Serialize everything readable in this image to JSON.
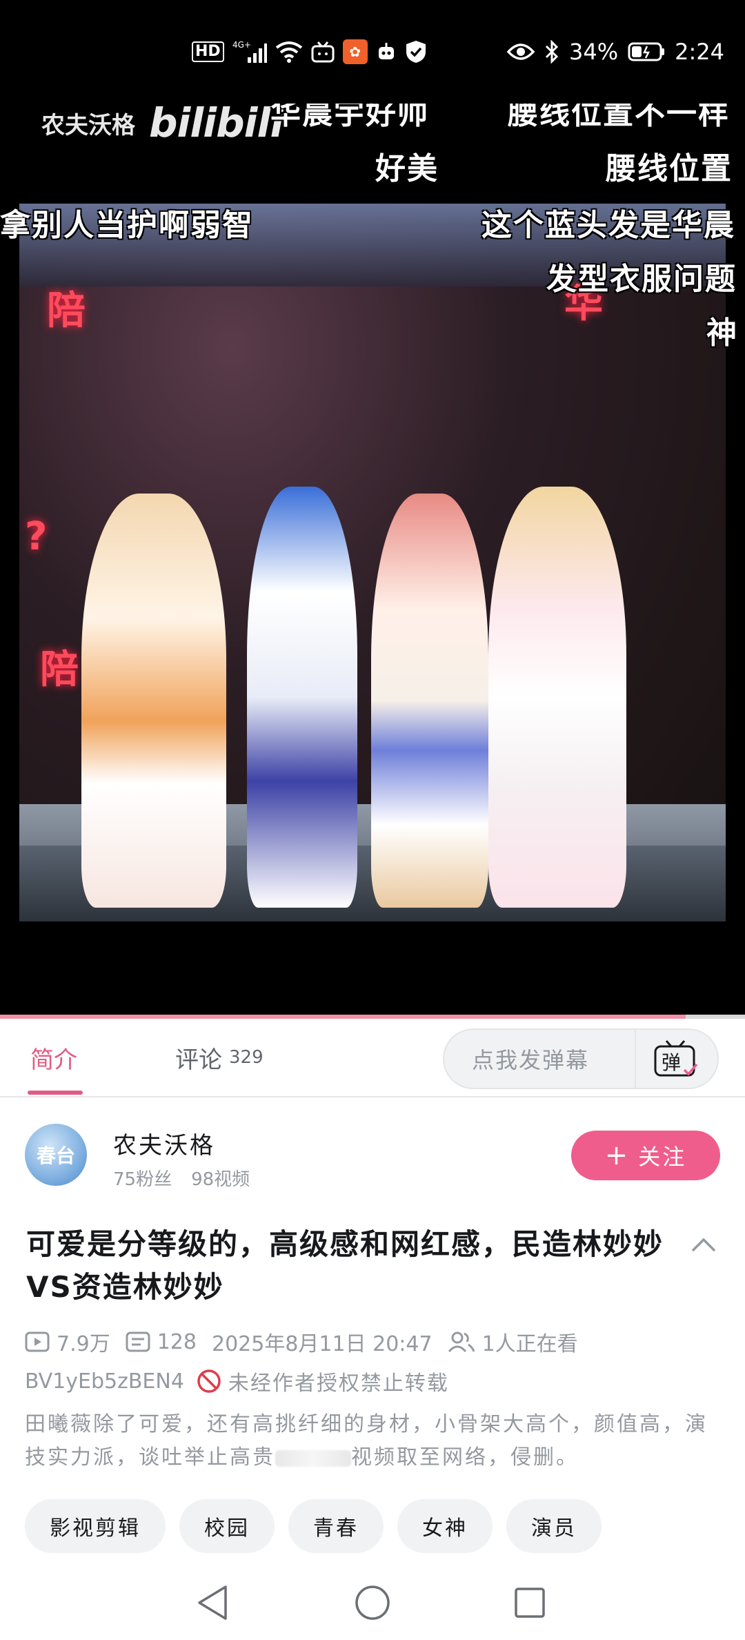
{
  "status_bar": {
    "left_icons": [
      "hd-icon",
      "4g-signal-icon",
      "wifi-icon",
      "tv-app-icon",
      "orange-app-icon",
      "robot-app-icon",
      "shield-app-icon"
    ],
    "hd_label": "HD",
    "network_label": "4G+",
    "battery_percent": "34%",
    "time": "2:24"
  },
  "video": {
    "watermark_author": "农夫沃格",
    "watermark_logo": "bilibili",
    "progress_fraction": 0.92,
    "danmaku": [
      "华晨宇好帅",
      "腰线位置不一样",
      "好美",
      "腰线位置",
      "拿别人当护啊弱智",
      "这个蓝头发是华晨",
      "发型衣服问题",
      "神"
    ],
    "neon_signs": [
      "陪",
      "华",
      "?",
      "陪"
    ]
  },
  "tabs": {
    "intro_label": "简介",
    "comments_label": "评论",
    "comments_count": "329",
    "danmaku_placeholder": "点我发弹幕",
    "danmaku_toggle_label": "弹"
  },
  "uploader": {
    "avatar_text": "春台",
    "name": "农夫沃格",
    "fans": "75粉丝",
    "videos": "98视频",
    "follow_label": "关注"
  },
  "video_info": {
    "title": "可爱是分等级的，高级感和网红感，民造林妙妙VS资造林妙妙",
    "views": "7.9万",
    "danmaku_count": "128",
    "date": "2025年8月11日 20:47",
    "watching": "1人正在看",
    "bvid": "BV1yEb5zBEN4",
    "repost_ban": "未经作者授权禁止转载",
    "description_part1": "田曦薇除了可爱，还有高挑纤细的身材，小骨架大高个，颜值高，演技实力派，谈吐举止高贵",
    "description_part2": "视频取至网络，侵删。"
  },
  "tags": [
    "影视剪辑",
    "校园",
    "青春",
    "女神",
    "演员"
  ],
  "colors": {
    "brand_pink": "#ef5d8c",
    "tab_active": "#e05c85",
    "muted_text": "#9499a0",
    "progress": "#f18fa6"
  }
}
